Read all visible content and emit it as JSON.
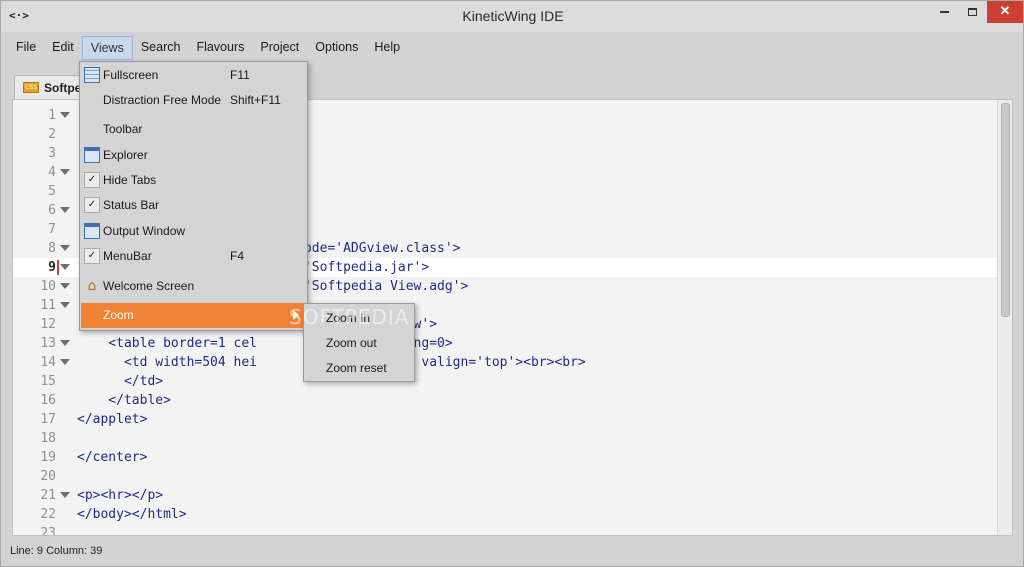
{
  "window": {
    "title": "KineticWing IDE",
    "icon_glyph": "<·>",
    "close_glyph": "✕"
  },
  "menubar": {
    "items": [
      "File",
      "Edit",
      "Views",
      "Search",
      "Flavours",
      "Project",
      "Options",
      "Help"
    ],
    "active": "Views"
  },
  "tab": {
    "label": "Softpe",
    "icon": "css-file-icon",
    "icon_text": "CSS"
  },
  "editor": {
    "current_line": 9,
    "lines": [
      {
        "n": "1",
        "fold": true,
        "code": ""
      },
      {
        "n": "2",
        "fold": false,
        "code": ""
      },
      {
        "n": "3",
        "fold": false,
        "code": ""
      },
      {
        "n": "4",
        "fold": true,
        "code": ""
      },
      {
        "n": "5",
        "fold": false,
        "code": ""
      },
      {
        "n": "6",
        "fold": true,
        "code": ""
      },
      {
        "n": "7",
        "fold": false,
        "code": ""
      },
      {
        "n": "8",
        "fold": true,
        "code": "                         04 code='ADGview.class'>"
      },
      {
        "n": "9",
        "fold": true,
        "code": "                           e='Softpedia.jar'>"
      },
      {
        "n": "10",
        "fold": true,
        "code": "                           e='Softpedia View.adg'>"
      },
      {
        "n": "11",
        "fold": true,
        "code": ""
      },
      {
        "n": "12",
        "fold": false,
        "code": "                                        View'>"
      },
      {
        "n": "13",
        "fold": true,
        "code": "    <table border=1 cel            ellpadding=0>"
      },
      {
        "n": "14",
        "fold": true,
        "code": "      <td width=504 hei          n='center' valign='top'><br><br>"
      },
      {
        "n": "15",
        "fold": false,
        "code": "      </td>"
      },
      {
        "n": "16",
        "fold": false,
        "code": "    </table>"
      },
      {
        "n": "17",
        "fold": false,
        "code": "</applet>"
      },
      {
        "n": "18",
        "fold": false,
        "code": ""
      },
      {
        "n": "19",
        "fold": false,
        "code": "</center>"
      },
      {
        "n": "20",
        "fold": false,
        "code": ""
      },
      {
        "n": "21",
        "fold": true,
        "code": "<p><hr></p>"
      },
      {
        "n": "22",
        "fold": false,
        "code": "</body></html>"
      },
      {
        "n": "23",
        "fold": false,
        "code": ""
      }
    ]
  },
  "views_menu": {
    "items": [
      {
        "label": "Fullscreen",
        "shortcut": "F11",
        "icon": "fullscreen-icon"
      },
      {
        "label": "Distraction Free Mode",
        "shortcut": "Shift+F11",
        "icon": ""
      },
      {
        "label": "Toolbar",
        "shortcut": "",
        "icon": ""
      },
      {
        "label": "Explorer",
        "shortcut": "",
        "icon": "explorer-icon"
      },
      {
        "label": "Hide Tabs",
        "shortcut": "",
        "icon": "checkbox-checked-icon"
      },
      {
        "label": "Status Bar",
        "shortcut": "",
        "icon": "checkbox-checked-icon"
      },
      {
        "label": "Output Window",
        "shortcut": "",
        "icon": "output-window-icon"
      },
      {
        "label": "MenuBar",
        "shortcut": "F4",
        "icon": "checkbox-checked-icon"
      },
      {
        "label": "Welcome Screen",
        "shortcut": "",
        "icon": "home-icon"
      },
      {
        "label": "Zoom",
        "shortcut": "",
        "icon": "",
        "submenu": true,
        "highlighted": true
      }
    ],
    "check_glyph": "✓",
    "home_glyph": "⌂"
  },
  "zoom_menu": {
    "items": [
      "Zoom In",
      "Zoom out",
      "Zoom reset"
    ]
  },
  "statusbar": {
    "text": "Line: 9   Column: 39"
  },
  "watermark": "SOFTPEDIA",
  "colors": {
    "menu_highlight": "#f08236",
    "close_button": "#c84031",
    "code_text": "#1f2a8c"
  }
}
